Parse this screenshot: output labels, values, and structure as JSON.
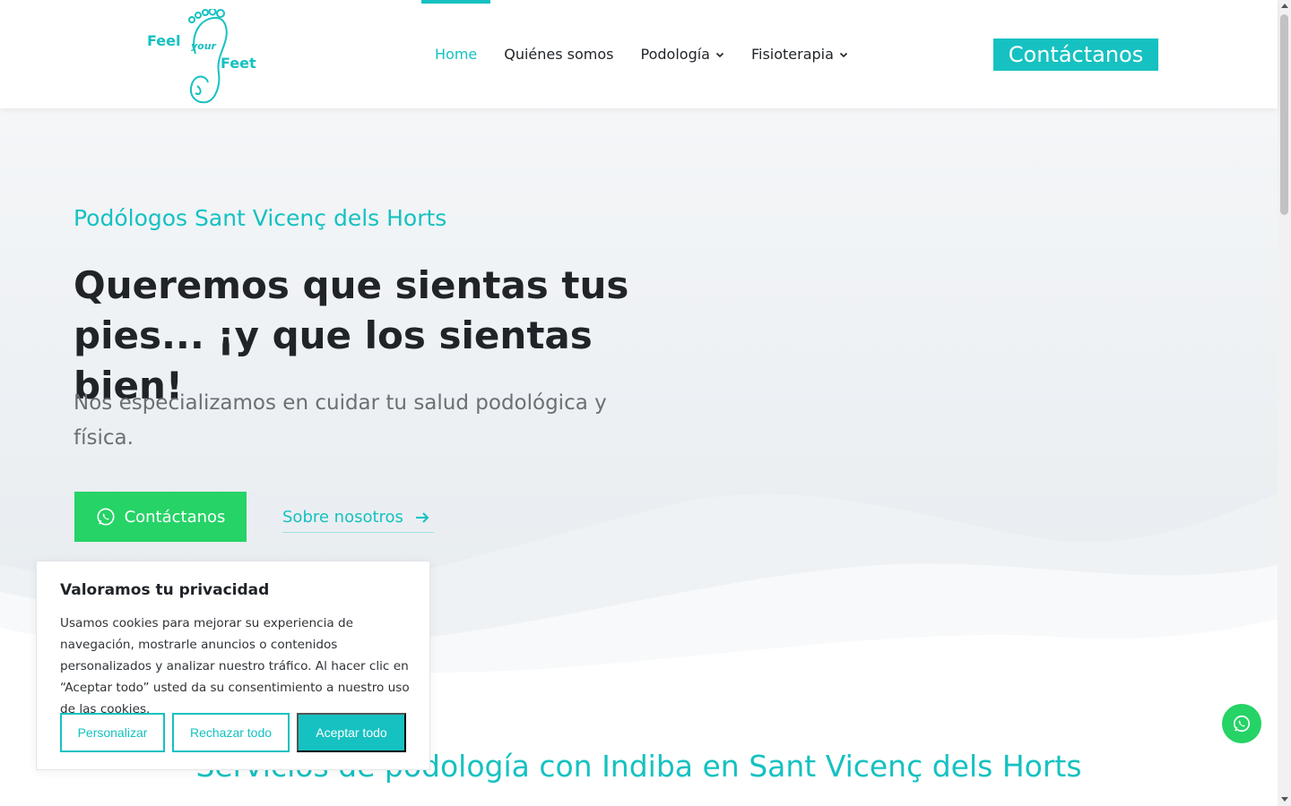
{
  "header": {
    "logo": {
      "word1": "Feel",
      "word2": "your",
      "word3": "Feet"
    },
    "nav": [
      {
        "label": "Home"
      },
      {
        "label": "Quiénes somos"
      },
      {
        "label": "Podología"
      },
      {
        "label": "Fisioterapia"
      }
    ],
    "cta_label": "Contáctanos"
  },
  "hero": {
    "eyebrow": "Podólogos Sant Vicenç dels Horts",
    "headline": "Queremos que sientas tus pies... ¡y que los sientas bien!",
    "lead": "Nos especializamos en cuidar tu salud podológica y física.",
    "whatsapp_button": "Contáctanos",
    "about_link": "Sobre nosotros"
  },
  "section": {
    "title": "Servicios de podología con Indiba en Sant Vicenç dels Horts"
  },
  "cookie": {
    "title": "Valoramos tu privacidad",
    "text": "Usamos cookies para mejorar su experiencia de navegación, mostrarle anuncios o contenidos personalizados y analizar nuestro tráfico. Al hacer clic en “Aceptar todo” usted da su consentimiento a nuestro uso de las cookies.",
    "customize": "Personalizar",
    "reject": "Rechazar todo",
    "accept": "Aceptar todo"
  },
  "colors": {
    "accent": "#16c1c1",
    "whatsapp": "#25d366"
  },
  "icons": [
    "foot-logo-icon",
    "chevron-down-icon",
    "whatsapp-icon",
    "arrow-right-icon"
  ]
}
